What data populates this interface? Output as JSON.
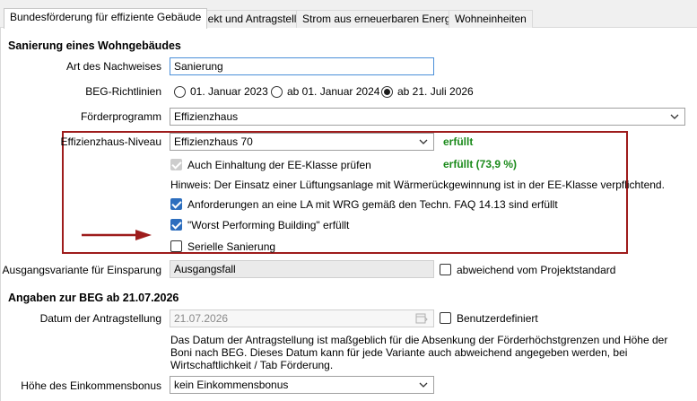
{
  "tabs": [
    {
      "label": "Bundesförderung für effiziente Gebäude",
      "active": true
    },
    {
      "label": "Objekt und Antragsteller",
      "active": false
    },
    {
      "label": "Strom aus erneuerbaren Energien",
      "active": false
    },
    {
      "label": "Wohneinheiten",
      "active": false
    }
  ],
  "section1": {
    "title": "Sanierung eines Wohngebäudes",
    "art_label": "Art des Nachweises",
    "art_value": "Sanierung",
    "beg_label": "BEG-Richtlinien",
    "beg_options": [
      "01. Januar 2023",
      "ab 01. Januar 2024",
      "ab 21. Juli 2026"
    ],
    "beg_selected": "ab 21. Juli 2026",
    "foerder_label": "Förderprogramm",
    "foerder_value": "Effizienzhaus",
    "eh_label": "Effizienzhaus-Niveau",
    "eh_value": "Effizienzhaus 70",
    "eh_status": "erfüllt",
    "ee_label": "Auch Einhaltung der EE-Klasse prüfen",
    "ee_status": "erfüllt (73,9 %)",
    "hinweis": "Hinweis: Der Einsatz einer Lüftungsanlage mit Wärmerückgewinnung ist in der EE-Klasse verpflichtend.",
    "la_label": "Anforderungen an eine LA mit WRG gemäß den Techn. FAQ 14.13 sind erfüllt",
    "wpb_label": "\"Worst Performing Building\" erfüllt",
    "seriell_label": "Serielle Sanierung",
    "ausgang_label": "Ausgangsvariante für Einsparung",
    "ausgang_value": "Ausgangsfall",
    "abweichend_label": "abweichend vom Projektstandard"
  },
  "section2": {
    "title": "Angaben zur BEG ab 21.07.2026",
    "datum_label": "Datum der Antragstellung",
    "datum_value": "21.07.2026",
    "benutzer_label": "Benutzerdefiniert",
    "info": "Das Datum der Antragstellung ist maßgeblich für die Absenkung der Förderhöchstgrenzen und Höhe der Boni nach BEG. Dieses Datum kann für jede Variante auch abweichend angegeben werden, bei Wirtschaftlichkeit / Tab Förderung.",
    "bonus_label": "Höhe des Einkommensbonus",
    "bonus_value": "kein Einkommensbonus"
  },
  "colors": {
    "accent": "#2d6ebe",
    "ok": "#1a8a1a",
    "highlight": "#9e1c1c"
  },
  "icons": [
    "chevron-down-icon",
    "calendar-icon",
    "arrow-right-icon"
  ]
}
